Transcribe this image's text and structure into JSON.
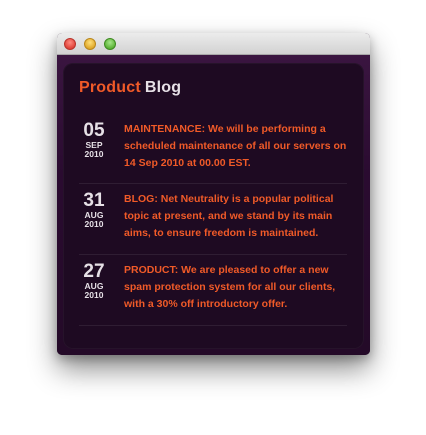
{
  "window": {
    "controls": [
      "close",
      "minimize",
      "zoom"
    ]
  },
  "header": {
    "title_part1": "Product",
    "title_part2": "Blog"
  },
  "posts": [
    {
      "day": "05",
      "month": "SEP",
      "year": "2010",
      "text": "MAINTENANCE: We will be performing a scheduled maintenance of all our servers on 14 Sep 2010 at 00.00 EST."
    },
    {
      "day": "31",
      "month": "AUG",
      "year": "2010",
      "text": "BLOG: Net Neutrality is a popular political topic at present, and we stand by its main aims, to ensure freedom is maintained."
    },
    {
      "day": "27",
      "month": "AUG",
      "year": "2010",
      "text": "PRODUCT: We are pleased to offer a new spam protection system for all our clients, with a 30% off introductory offer."
    }
  ],
  "colors": {
    "accent": "#f05a28",
    "heading_secondary": "#e6e0e6",
    "panel_bg": "#1e0a22"
  }
}
